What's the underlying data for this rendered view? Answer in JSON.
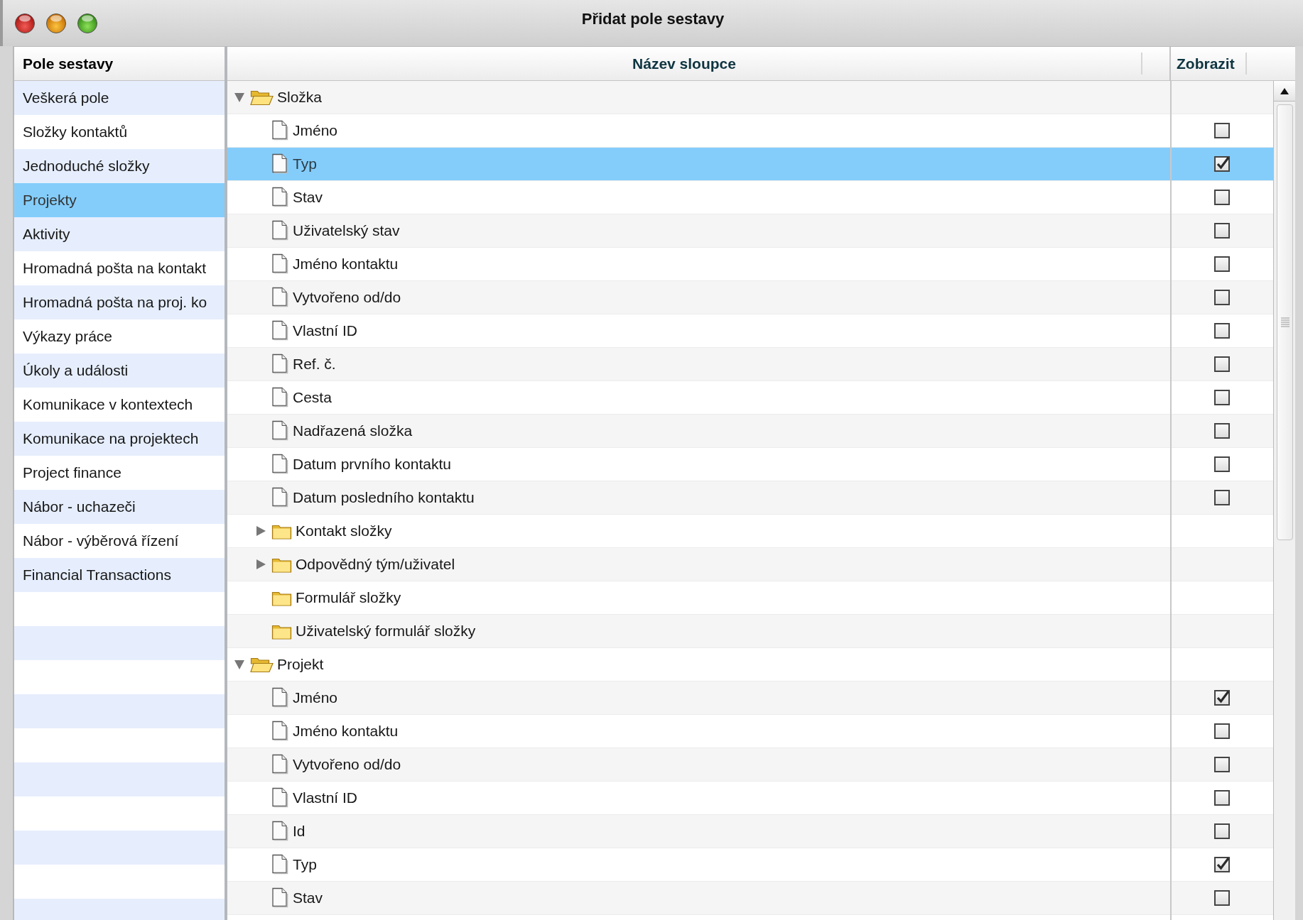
{
  "window": {
    "title": "Přidat pole sestavy"
  },
  "sidebar": {
    "header": "Pole sestavy",
    "items": [
      {
        "label": "Veškerá pole",
        "selected": false
      },
      {
        "label": "Složky kontaktů",
        "selected": false
      },
      {
        "label": "Jednoduché složky",
        "selected": false
      },
      {
        "label": "Projekty",
        "selected": true
      },
      {
        "label": "Aktivity",
        "selected": false
      },
      {
        "label": "Hromadná pošta na kontakt",
        "selected": false
      },
      {
        "label": "Hromadná pošta na proj. ko",
        "selected": false
      },
      {
        "label": "Výkazy práce",
        "selected": false
      },
      {
        "label": "Úkoly a události",
        "selected": false
      },
      {
        "label": "Komunikace v kontextech",
        "selected": false
      },
      {
        "label": "Komunikace na projektech",
        "selected": false
      },
      {
        "label": "Project finance",
        "selected": false
      },
      {
        "label": "Nábor - uchazeči",
        "selected": false
      },
      {
        "label": "Nábor - výběrová řízení",
        "selected": false
      },
      {
        "label": "Financial Transactions",
        "selected": false
      }
    ]
  },
  "tree": {
    "columns": [
      "Název sloupce",
      "Zobrazit"
    ],
    "rows": [
      {
        "kind": "group",
        "label": "Složka",
        "expanded": true,
        "selected": false,
        "children": [
          {
            "kind": "field",
            "label": "Jméno",
            "checked": false,
            "selected": false
          },
          {
            "kind": "field",
            "label": "Typ",
            "checked": true,
            "selected": true
          },
          {
            "kind": "field",
            "label": "Stav",
            "checked": false,
            "selected": false
          },
          {
            "kind": "field",
            "label": "Uživatelský stav",
            "checked": false,
            "selected": false
          },
          {
            "kind": "field",
            "label": "Jméno kontaktu",
            "checked": false,
            "selected": false
          },
          {
            "kind": "field",
            "label": "Vytvořeno od/do",
            "checked": false,
            "selected": false
          },
          {
            "kind": "field",
            "label": "Vlastní ID",
            "checked": false,
            "selected": false
          },
          {
            "kind": "field",
            "label": "Ref. č.",
            "checked": false,
            "selected": false
          },
          {
            "kind": "field",
            "label": "Cesta",
            "checked": false,
            "selected": false
          },
          {
            "kind": "field",
            "label": "Nadřazená složka",
            "checked": false,
            "selected": false
          },
          {
            "kind": "field",
            "label": "Datum prvního kontaktu",
            "checked": false,
            "selected": false
          },
          {
            "kind": "field",
            "label": "Datum posledního kontaktu",
            "checked": false,
            "selected": false
          },
          {
            "kind": "group",
            "label": "Kontakt složky",
            "expanded": false,
            "selected": false
          },
          {
            "kind": "group",
            "label": "Odpovědný tým/uživatel",
            "expanded": false,
            "selected": false
          },
          {
            "kind": "folder",
            "label": "Formulář složky",
            "selected": false
          },
          {
            "kind": "folder",
            "label": "Uživatelský formulář složky",
            "selected": false
          }
        ]
      },
      {
        "kind": "group",
        "label": "Projekt",
        "expanded": true,
        "selected": false,
        "children": [
          {
            "kind": "field",
            "label": "Jméno",
            "checked": true,
            "selected": false
          },
          {
            "kind": "field",
            "label": "Jméno kontaktu",
            "checked": false,
            "selected": false
          },
          {
            "kind": "field",
            "label": "Vytvořeno od/do",
            "checked": false,
            "selected": false
          },
          {
            "kind": "field",
            "label": "Vlastní ID",
            "checked": false,
            "selected": false
          },
          {
            "kind": "field",
            "label": "Id",
            "checked": false,
            "selected": false
          },
          {
            "kind": "field",
            "label": "Typ",
            "checked": true,
            "selected": false
          },
          {
            "kind": "field",
            "label": "Stav",
            "checked": false,
            "selected": false
          }
        ]
      }
    ]
  }
}
